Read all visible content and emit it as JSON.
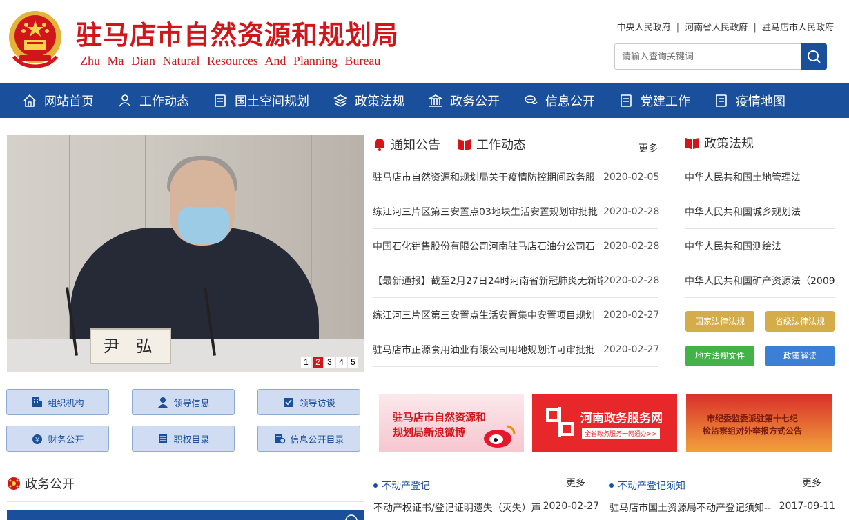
{
  "header": {
    "title": "驻马店市自然资源和规划局",
    "subtitle": "Zhu Ma Dian Natural Resources And Planning Bureau",
    "gov_links": [
      "中央人民政府",
      "河南省人民政府",
      "驻马店市人民政府"
    ],
    "gov_sep": "|",
    "search_placeholder": "请输入查询关键词"
  },
  "nav": {
    "items": [
      {
        "label": "网站首页",
        "icon": "home-icon"
      },
      {
        "label": "工作动态",
        "icon": "user-icon"
      },
      {
        "label": "国土空间规划",
        "icon": "document-icon"
      },
      {
        "label": "政策法规",
        "icon": "layers-icon"
      },
      {
        "label": "政务公开",
        "icon": "building-icon"
      },
      {
        "label": "信息公开",
        "icon": "chat-icon"
      },
      {
        "label": "党建工作",
        "icon": "document-icon"
      },
      {
        "label": "疫情地图",
        "icon": "document-icon"
      }
    ]
  },
  "slider": {
    "nameplate": "尹 弘",
    "pages": [
      "1",
      "2",
      "3",
      "4",
      "5"
    ],
    "active_page": "2"
  },
  "news": {
    "tab_notice": "通知公告",
    "tab_work": "工作动态",
    "more": "更多",
    "items": [
      {
        "title": "驻马店市自然资源和规划局关于疫情防控期间政务服",
        "date": "2020-02-05"
      },
      {
        "title": "练江河三片区第三安置点03地块生活安置规划审批批",
        "date": "2020-02-28"
      },
      {
        "title": "中国石化销售股份有限公司河南驻马店石油分公司石",
        "date": "2020-02-28"
      },
      {
        "title": "【最新通报】截至2月27日24时河南省新冠肺炎无新增",
        "date": "2020-02-28"
      },
      {
        "title": "练江河三片区第三安置点生活安置集中安置项目规划",
        "date": "2020-02-27"
      },
      {
        "title": "驻马店市正源食用油业有限公司用地规划许可审批批",
        "date": "2020-02-27"
      }
    ]
  },
  "policy": {
    "title": "政策法规",
    "items": [
      "中华人民共和国土地管理法",
      "中华人民共和国城乡规划法",
      "中华人民共和国测绘法",
      "中华人民共和国矿产资源法（2009"
    ],
    "buttons": [
      {
        "label": "国家法律法规",
        "color": "#d4ac4a"
      },
      {
        "label": "省级法律法规",
        "color": "#d4ac4a"
      },
      {
        "label": "地方法规文件",
        "color": "#43b349"
      },
      {
        "label": "政策解读",
        "color": "#3b7fd6"
      }
    ]
  },
  "quick_links": [
    {
      "label": "组织机构",
      "icon": "org-icon"
    },
    {
      "label": "领导信息",
      "icon": "leader-icon"
    },
    {
      "label": "领导访谈",
      "icon": "interview-icon"
    },
    {
      "label": "财务公开",
      "icon": "finance-icon"
    },
    {
      "label": "职权目录",
      "icon": "list-icon"
    },
    {
      "label": "信息公开目录",
      "icon": "catalog-icon"
    }
  ],
  "banners": {
    "weibo_line1": "驻马店市自然资源和",
    "weibo_line2": "规划局新浪微博",
    "henan_title": "河南政务服务网",
    "henan_sub": "全省政务服务一网通办>>",
    "jiwei_line1": "市纪委监委派驻第十七纪",
    "jiwei_line2": "检监察组对外举报方式公告"
  },
  "bottom": {
    "zwgk_title": "政务公开",
    "estate_title": "不动产登记",
    "estate_more": "更多",
    "estate_row": {
      "title": "不动产权证书/登记证明遗失（灭失）声",
      "date": "2020-02-27"
    },
    "notice_title": "不动产登记须知",
    "notice_more": "更多",
    "notice_row": {
      "title": "驻马店市国土资源局不动产登记须知--",
      "date": "2017-09-11"
    }
  },
  "colors": {
    "brand_red": "#d0161b",
    "nav_blue": "#1a4f9c"
  }
}
